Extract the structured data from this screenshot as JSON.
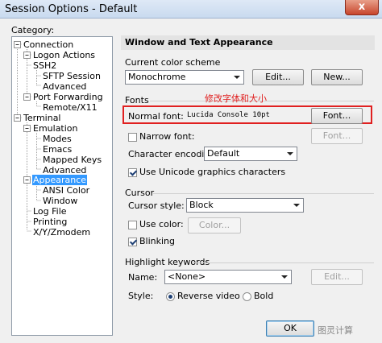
{
  "window": {
    "title": "Session Options - Default",
    "close_glyph": "x"
  },
  "category": {
    "label": "Category:",
    "tree": [
      {
        "label": "Connection"
      },
      {
        "label": "Logon Actions"
      },
      {
        "label": "SSH2"
      },
      {
        "label": "SFTP Session"
      },
      {
        "label": "Advanced"
      },
      {
        "label": "Port Forwarding"
      },
      {
        "label": "Remote/X11"
      },
      {
        "label": "Terminal"
      },
      {
        "label": "Emulation"
      },
      {
        "label": "Modes"
      },
      {
        "label": "Emacs"
      },
      {
        "label": "Mapped Keys"
      },
      {
        "label": "Advanced"
      },
      {
        "label": "Appearance"
      },
      {
        "label": "ANSI Color"
      },
      {
        "label": "Window"
      },
      {
        "label": "Log File"
      },
      {
        "label": "Printing"
      },
      {
        "label": "X/Y/Zmodem"
      }
    ],
    "selected_index": 13
  },
  "panel": {
    "header": "Window and Text Appearance",
    "color_scheme": {
      "label": "Current color scheme",
      "value": "Monochrome",
      "edit": "Edit...",
      "new": "New..."
    },
    "fonts": {
      "label": "Fonts",
      "annotation": "修改字体和大小",
      "normal_label": "Normal font:",
      "normal_value": "Lucida Console 10pt",
      "font_button": "Font...",
      "narrow_label": "Narrow font:",
      "narrow_button": "Font...",
      "encoding_label": "Character encoding:",
      "encoding_value": "Default",
      "unicode_label": "Use Unicode graphics characters"
    },
    "cursor": {
      "label": "Cursor",
      "style_label": "Cursor style:",
      "style_value": "Block",
      "use_color_label": "Use color:",
      "color_button": "Color...",
      "blinking_label": "Blinking"
    },
    "highlight": {
      "label": "Highlight keywords",
      "name_label": "Name:",
      "name_value": "<None>",
      "edit": "Edit...",
      "style_label": "Style:",
      "reverse_video": "Reverse video",
      "bold": "Bold"
    }
  },
  "footer": {
    "ok": "OK",
    "watermark": "图灵计算"
  }
}
